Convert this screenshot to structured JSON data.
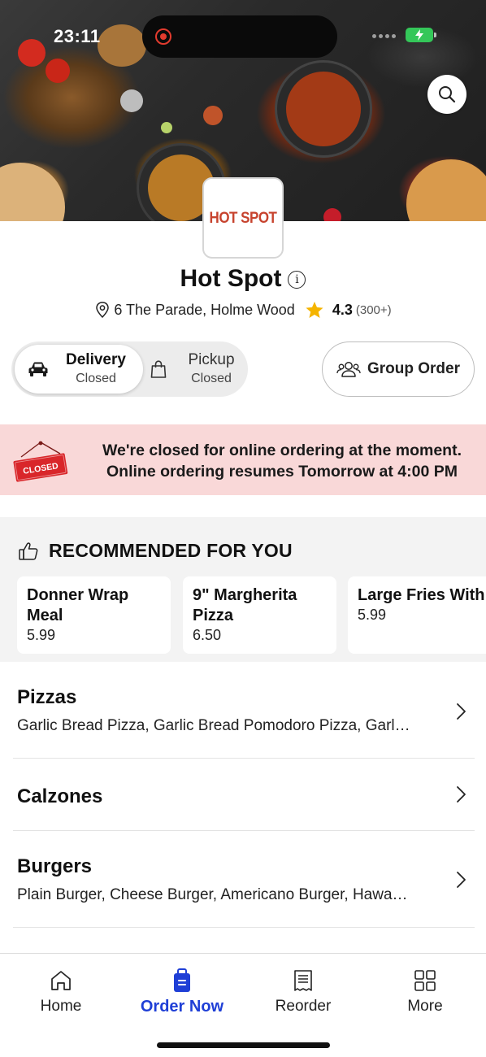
{
  "status_bar": {
    "time": "23:11"
  },
  "store": {
    "logo_text": "HOT SPOT",
    "name": "Hot Spot",
    "address": "6 The Parade, Holme Wood",
    "rating": "4.3",
    "rating_count": "(300+)"
  },
  "order_mode": {
    "delivery_label": "Delivery",
    "delivery_status": "Closed",
    "pickup_label": "Pickup",
    "pickup_status": "Closed",
    "selected": "Delivery"
  },
  "group_order_label": "Group Order",
  "closed_banner": {
    "sign_text": "CLOSED",
    "line1": "We're closed for online ordering at the moment.",
    "line2": "Online ordering resumes Tomorrow at 4:00 PM"
  },
  "recommended": {
    "title": "RECOMMENDED FOR YOU",
    "items": [
      {
        "name": "Donner Wrap Meal",
        "price": "5.99"
      },
      {
        "name": "9\" Margherita Pizza",
        "price": "6.50"
      },
      {
        "name": "Large Fries With Donner Meat",
        "price": "5.99"
      }
    ]
  },
  "categories": [
    {
      "name": "Pizzas",
      "desc": "Garlic Bread Pizza, Garlic Bread Pomodoro Pizza, Garl…"
    },
    {
      "name": "Calzones",
      "desc": ""
    },
    {
      "name": "Burgers",
      "desc": "Plain Burger, Cheese Burger, Americano Burger, Hawa…"
    }
  ],
  "nav": {
    "home": "Home",
    "order_now": "Order Now",
    "reorder": "Reorder",
    "more": "More",
    "active": "Order Now"
  },
  "colors": {
    "accent": "#1f3fd6",
    "banner_bg": "#f9d8d8",
    "logo_red": "#c7432e",
    "star": "#f5b400"
  }
}
